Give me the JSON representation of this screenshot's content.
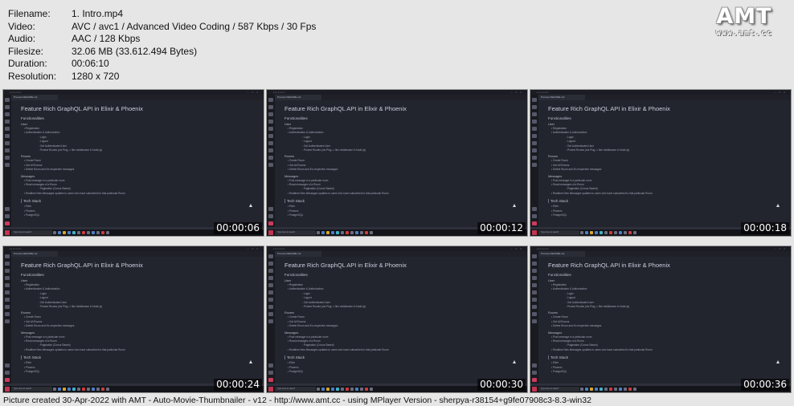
{
  "meta": [
    {
      "label": "Filename:",
      "value": "1. Intro.mp4"
    },
    {
      "label": "Video:",
      "value": "AVC / avc1 / Advanced Video Coding / 587 Kbps / 30 Fps"
    },
    {
      "label": "Audio:",
      "value": "AAC / 128 Kbps"
    },
    {
      "label": "Filesize:",
      "value": "32.06 MB (33.612.494 Bytes)"
    },
    {
      "label": "Duration:",
      "value": "00:06:10"
    },
    {
      "label": "Resolution:",
      "value": "1280 x 720"
    }
  ],
  "logo": {
    "text": "AMT",
    "url": "www.amt.cc"
  },
  "thumbnails": [
    {
      "timestamp": "00:00:06"
    },
    {
      "timestamp": "00:00:12"
    },
    {
      "timestamp": "00:00:18"
    },
    {
      "timestamp": "00:00:24"
    },
    {
      "timestamp": "00:00:30"
    },
    {
      "timestamp": "00:00:36"
    }
  ],
  "editor": {
    "tab": "Preview README.md",
    "title": "Feature Rich GraphQL API in Elixir & Phoenix",
    "functionalities": "Functionalities",
    "user": "User",
    "registration": "Registration",
    "auth": "Authentication & Authorization",
    "login": "Login",
    "logout": "Logout",
    "get_user": "Get Authenticated User",
    "protect": "Protect Routes (via Plug -> like middleware in Node.js)",
    "rooms": "Rooms",
    "create_room": "Create Room",
    "get_rooms": "Get All Rooms",
    "delete_room": "Delete Room and it's respective messages",
    "messages": "Messages",
    "post_message": "Post message in a particular room",
    "read_messages": "Read messages of a Room",
    "pagination": "Pagination (Cursor Based)",
    "realtime": "Realtime New Messages updates to users who have subscribed to that particular Room",
    "tech_stack": "Tech Stack",
    "elixir": "Elixir",
    "phoenix": "Phoenix",
    "postgres": "PostgreSQL",
    "taskbar_search": "Type here to search"
  },
  "footer": "Picture created 30-Apr-2022 with AMT - Auto-Movie-Thumbnailer - v12 - http://www.amt.cc - using MPlayer Version - sherpya-r38154+g9fe07908c3-8.3-win32"
}
